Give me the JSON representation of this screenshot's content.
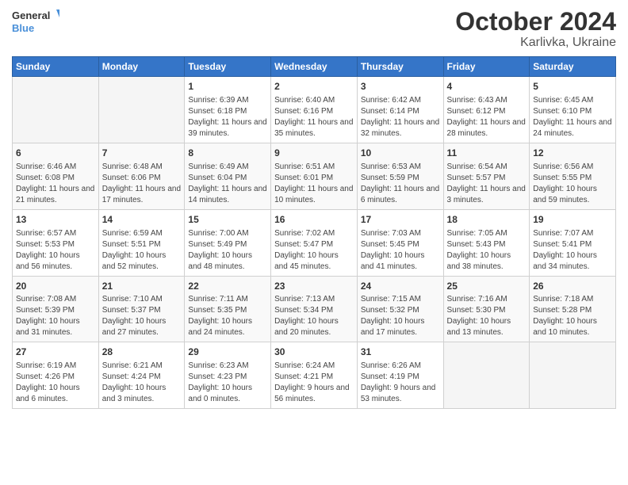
{
  "header": {
    "logo": {
      "line1": "General",
      "line2": "Blue"
    },
    "title": "October 2024",
    "subtitle": "Karlivka, Ukraine"
  },
  "weekdays": [
    "Sunday",
    "Monday",
    "Tuesday",
    "Wednesday",
    "Thursday",
    "Friday",
    "Saturday"
  ],
  "weeks": [
    [
      {
        "day": "",
        "info": ""
      },
      {
        "day": "",
        "info": ""
      },
      {
        "day": "1",
        "info": "Sunrise: 6:39 AM\nSunset: 6:18 PM\nDaylight: 11 hours and 39 minutes."
      },
      {
        "day": "2",
        "info": "Sunrise: 6:40 AM\nSunset: 6:16 PM\nDaylight: 11 hours and 35 minutes."
      },
      {
        "day": "3",
        "info": "Sunrise: 6:42 AM\nSunset: 6:14 PM\nDaylight: 11 hours and 32 minutes."
      },
      {
        "day": "4",
        "info": "Sunrise: 6:43 AM\nSunset: 6:12 PM\nDaylight: 11 hours and 28 minutes."
      },
      {
        "day": "5",
        "info": "Sunrise: 6:45 AM\nSunset: 6:10 PM\nDaylight: 11 hours and 24 minutes."
      }
    ],
    [
      {
        "day": "6",
        "info": "Sunrise: 6:46 AM\nSunset: 6:08 PM\nDaylight: 11 hours and 21 minutes."
      },
      {
        "day": "7",
        "info": "Sunrise: 6:48 AM\nSunset: 6:06 PM\nDaylight: 11 hours and 17 minutes."
      },
      {
        "day": "8",
        "info": "Sunrise: 6:49 AM\nSunset: 6:04 PM\nDaylight: 11 hours and 14 minutes."
      },
      {
        "day": "9",
        "info": "Sunrise: 6:51 AM\nSunset: 6:01 PM\nDaylight: 11 hours and 10 minutes."
      },
      {
        "day": "10",
        "info": "Sunrise: 6:53 AM\nSunset: 5:59 PM\nDaylight: 11 hours and 6 minutes."
      },
      {
        "day": "11",
        "info": "Sunrise: 6:54 AM\nSunset: 5:57 PM\nDaylight: 11 hours and 3 minutes."
      },
      {
        "day": "12",
        "info": "Sunrise: 6:56 AM\nSunset: 5:55 PM\nDaylight: 10 hours and 59 minutes."
      }
    ],
    [
      {
        "day": "13",
        "info": "Sunrise: 6:57 AM\nSunset: 5:53 PM\nDaylight: 10 hours and 56 minutes."
      },
      {
        "day": "14",
        "info": "Sunrise: 6:59 AM\nSunset: 5:51 PM\nDaylight: 10 hours and 52 minutes."
      },
      {
        "day": "15",
        "info": "Sunrise: 7:00 AM\nSunset: 5:49 PM\nDaylight: 10 hours and 48 minutes."
      },
      {
        "day": "16",
        "info": "Sunrise: 7:02 AM\nSunset: 5:47 PM\nDaylight: 10 hours and 45 minutes."
      },
      {
        "day": "17",
        "info": "Sunrise: 7:03 AM\nSunset: 5:45 PM\nDaylight: 10 hours and 41 minutes."
      },
      {
        "day": "18",
        "info": "Sunrise: 7:05 AM\nSunset: 5:43 PM\nDaylight: 10 hours and 38 minutes."
      },
      {
        "day": "19",
        "info": "Sunrise: 7:07 AM\nSunset: 5:41 PM\nDaylight: 10 hours and 34 minutes."
      }
    ],
    [
      {
        "day": "20",
        "info": "Sunrise: 7:08 AM\nSunset: 5:39 PM\nDaylight: 10 hours and 31 minutes."
      },
      {
        "day": "21",
        "info": "Sunrise: 7:10 AM\nSunset: 5:37 PM\nDaylight: 10 hours and 27 minutes."
      },
      {
        "day": "22",
        "info": "Sunrise: 7:11 AM\nSunset: 5:35 PM\nDaylight: 10 hours and 24 minutes."
      },
      {
        "day": "23",
        "info": "Sunrise: 7:13 AM\nSunset: 5:34 PM\nDaylight: 10 hours and 20 minutes."
      },
      {
        "day": "24",
        "info": "Sunrise: 7:15 AM\nSunset: 5:32 PM\nDaylight: 10 hours and 17 minutes."
      },
      {
        "day": "25",
        "info": "Sunrise: 7:16 AM\nSunset: 5:30 PM\nDaylight: 10 hours and 13 minutes."
      },
      {
        "day": "26",
        "info": "Sunrise: 7:18 AM\nSunset: 5:28 PM\nDaylight: 10 hours and 10 minutes."
      }
    ],
    [
      {
        "day": "27",
        "info": "Sunrise: 6:19 AM\nSunset: 4:26 PM\nDaylight: 10 hours and 6 minutes."
      },
      {
        "day": "28",
        "info": "Sunrise: 6:21 AM\nSunset: 4:24 PM\nDaylight: 10 hours and 3 minutes."
      },
      {
        "day": "29",
        "info": "Sunrise: 6:23 AM\nSunset: 4:23 PM\nDaylight: 10 hours and 0 minutes."
      },
      {
        "day": "30",
        "info": "Sunrise: 6:24 AM\nSunset: 4:21 PM\nDaylight: 9 hours and 56 minutes."
      },
      {
        "day": "31",
        "info": "Sunrise: 6:26 AM\nSunset: 4:19 PM\nDaylight: 9 hours and 53 minutes."
      },
      {
        "day": "",
        "info": ""
      },
      {
        "day": "",
        "info": ""
      }
    ]
  ]
}
